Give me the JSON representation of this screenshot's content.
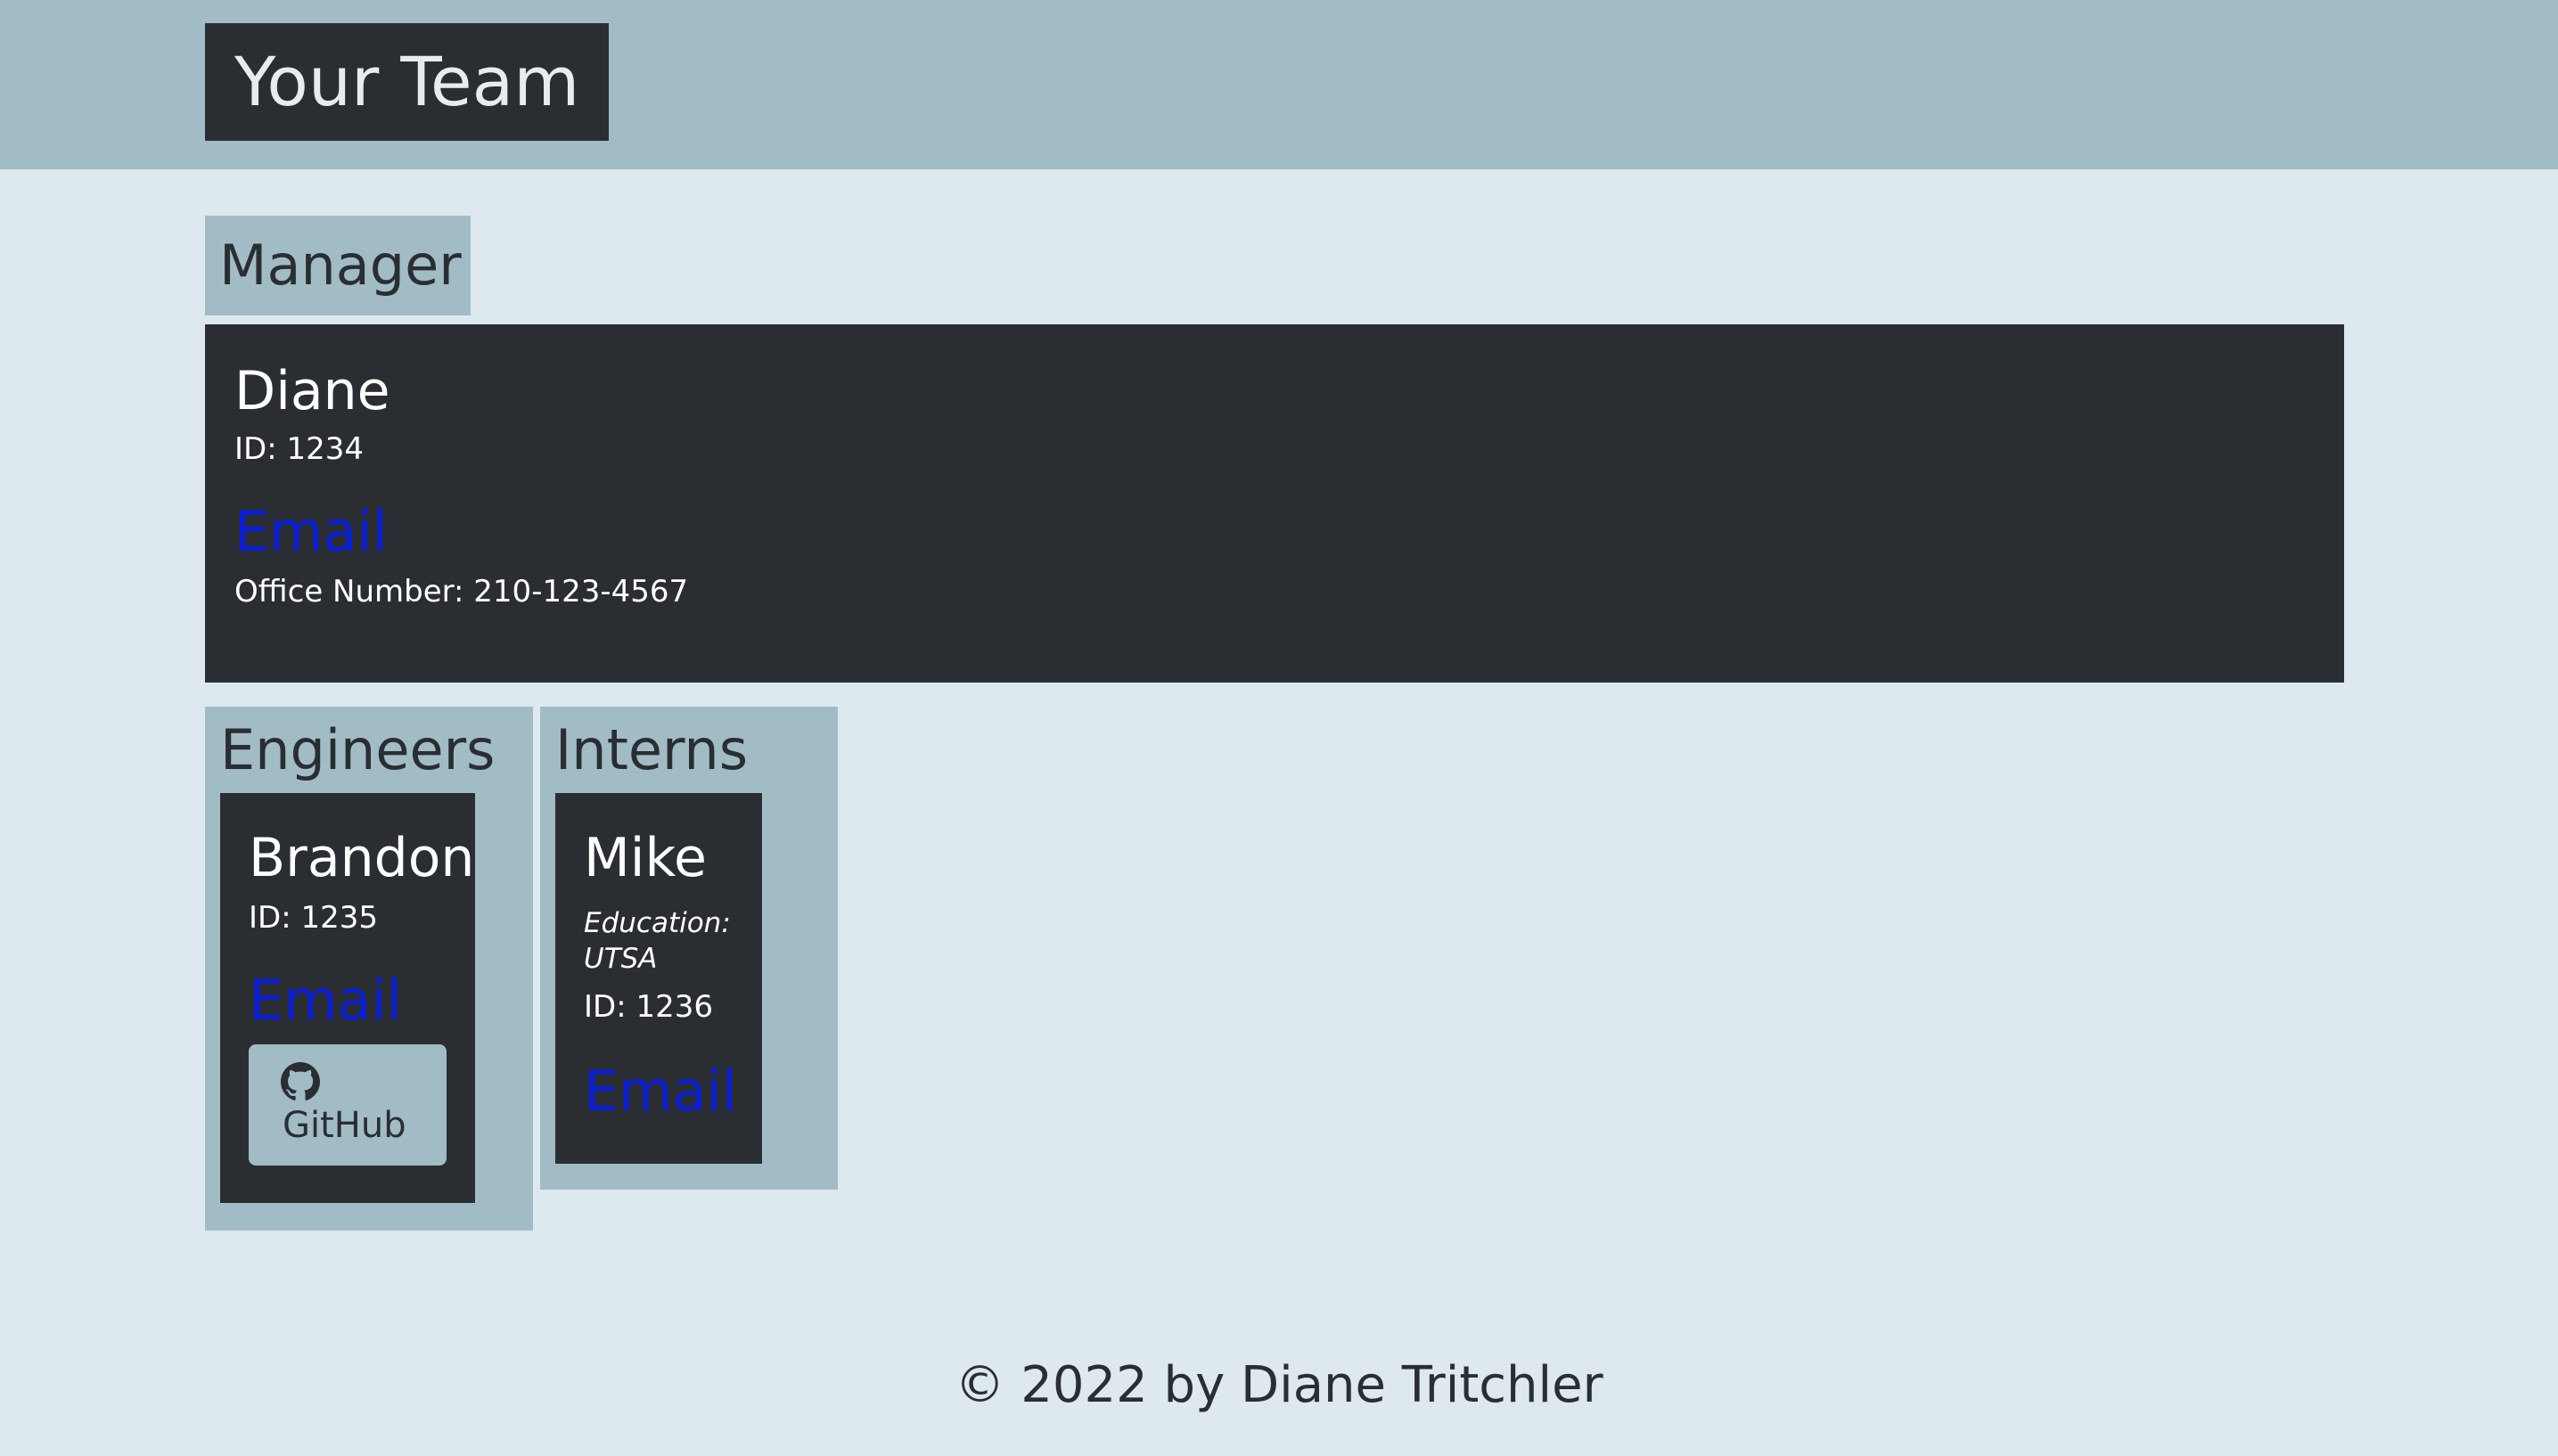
{
  "header": {
    "title": "Your Team"
  },
  "manager_section": {
    "label": "Manager",
    "card": {
      "name": "Diane",
      "id_text": "ID: 1234",
      "email_label": "Email",
      "office_text": "Office Number: 210-123-4567"
    }
  },
  "engineers_section": {
    "label": "Engineers",
    "cards": [
      {
        "name": "Brandon",
        "id_text": "ID: 1235",
        "email_label": "Email",
        "github_label": "GitHub",
        "github_icon": "github-icon"
      }
    ]
  },
  "interns_section": {
    "label": "Interns",
    "cards": [
      {
        "name": "Mike",
        "education_line1": "Education:",
        "education_line2": "UTSA",
        "id_text": "ID: 1236",
        "email_label": "Email"
      }
    ]
  },
  "footer": {
    "text": "© 2022 by Diane Tritchler"
  },
  "colors": {
    "page_background": "#dde8ef",
    "accent_blue_gray": "#a2bcc6",
    "card_dark": "#2a2e33",
    "link_blue": "#0a1ed6",
    "header_text": "#e6ecef"
  }
}
